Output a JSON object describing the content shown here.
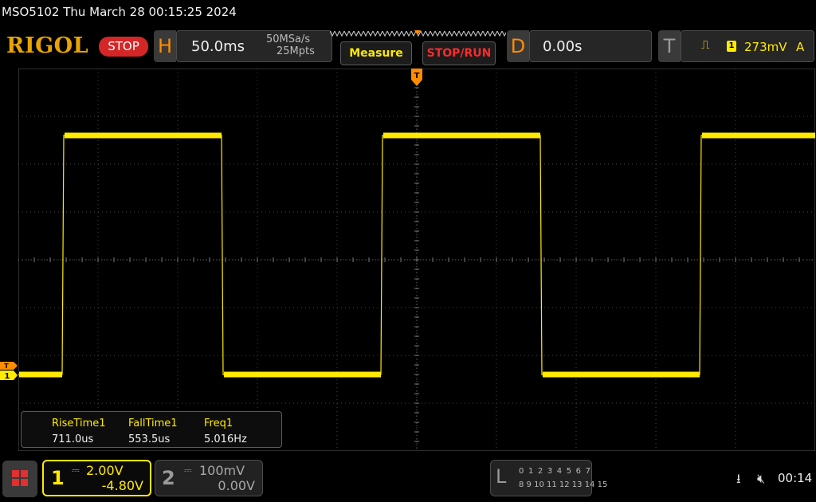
{
  "title": "MSO5102  Thu March 28 00:15:25 2024",
  "header": {
    "logo": "RIGOL",
    "status": "STOP",
    "horizontal": {
      "letter": "H",
      "scale": "50.0ms",
      "sample_rate": "50MSa/s",
      "memory_depth": "25Mpts"
    },
    "measure_label": "Measure",
    "stoprun_label": "STOP/RUN",
    "delay": {
      "letter": "D",
      "value": "0.00s"
    },
    "trigger": {
      "letter": "T",
      "slope_icon": "rising-edge-icon",
      "channel": "1",
      "level": "273mV",
      "mode": "A"
    }
  },
  "waveform": {
    "channel": "CH1",
    "color": "#ffea00",
    "grid_divisions": {
      "horizontal": 10,
      "vertical": 8
    },
    "low_level_volts": 0.0,
    "high_level_volts": 10.0,
    "rising_edge_times_div": [
      0.55,
      4.55,
      8.55
    ],
    "falling_edge_times_div": [
      2.55,
      6.55
    ]
  },
  "measurements": {
    "headers": [
      "RiseTime1",
      "FallTime1",
      "Freq1"
    ],
    "values": [
      "711.0us",
      "553.5us",
      "5.016Hz"
    ]
  },
  "markers": {
    "trigger_position": "T",
    "ch1_ground": "1",
    "ch1_trigger_level": "T"
  },
  "bottom": {
    "ch1": {
      "number": "1",
      "scale": "2.00V",
      "offset": "-4.80V"
    },
    "ch2": {
      "number": "2",
      "scale": "100mV",
      "offset": "0.00V"
    },
    "la": {
      "letter": "L",
      "row1": "0 1 2 3  4 5 6 7",
      "row2": "8 9 10 11 12 13 14 15"
    },
    "usb_icon": "usb-icon",
    "sound_icon": "speaker-muted-icon",
    "clock": "00:14"
  },
  "colors": {
    "ch1": "#ffea00",
    "accent": "#ff8c00",
    "stop": "#d42626"
  }
}
